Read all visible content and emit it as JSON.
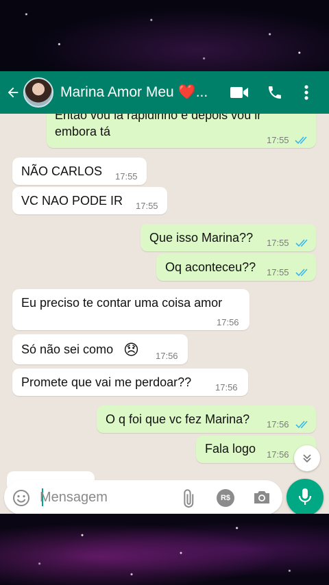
{
  "header": {
    "contact_name": "Marina Amor Meu ❤️...",
    "icons": [
      "back-arrow-icon",
      "avatar",
      "video-call-icon",
      "phone-icon",
      "more-vert-icon"
    ],
    "color": "#008069"
  },
  "messages": [
    {
      "dir": "out",
      "text_line1": "Então vou lá rapidinho e depois vou ir",
      "text_line2": "embora tá",
      "time": "17:55",
      "ticks": "read"
    },
    {
      "dir": "in",
      "text": "NÃO CARLOS",
      "time": "17:55"
    },
    {
      "dir": "in",
      "text": "VC NAO PODE IR",
      "time": "17:55"
    },
    {
      "dir": "out",
      "text": "Que isso Marina??",
      "time": "17:55",
      "ticks": "read"
    },
    {
      "dir": "out",
      "text": "Oq aconteceu??",
      "time": "17:55",
      "ticks": "read"
    },
    {
      "dir": "in",
      "text": "Eu preciso te contar uma coisa amor",
      "time": "17:56"
    },
    {
      "dir": "in",
      "text": "Só não sei como",
      "emoji": "😞",
      "time": "17:56"
    },
    {
      "dir": "in",
      "text": "Promete que vai me perdoar??",
      "time": "17:56"
    },
    {
      "dir": "out",
      "text": "O q foi que vc fez Marina?",
      "time": "17:56",
      "ticks": "read"
    },
    {
      "dir": "out",
      "text": "Fala logo",
      "time": "17:56",
      "ticks": "sent"
    }
  ],
  "composer": {
    "placeholder": "Mensagem",
    "pay_label": "R$"
  },
  "colors": {
    "incoming": "#ffffff",
    "outgoing": "#dcf8c6",
    "chat_bg": "#ece5dd",
    "read_ticks": "#34b7f1",
    "accent": "#00a884"
  }
}
